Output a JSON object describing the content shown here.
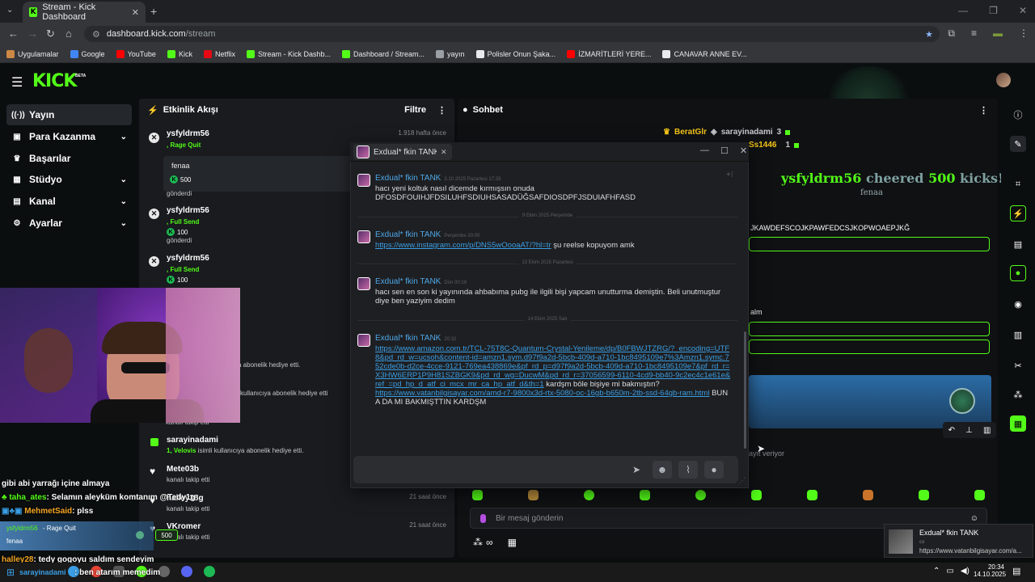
{
  "browser": {
    "tab_title": "Stream - Kick Dashboard",
    "url_host": "dashboard.kick.com",
    "url_path": "/stream",
    "bookmarks": [
      {
        "label": "Uygulamalar",
        "color": "#c84"
      },
      {
        "label": "Google",
        "color": "#4285f4"
      },
      {
        "label": "YouTube",
        "color": "#ff0000"
      },
      {
        "label": "Kick",
        "color": "#53fc18"
      },
      {
        "label": "Netflix",
        "color": "#e50914"
      },
      {
        "label": "Stream - Kick Dashb...",
        "color": "#53fc18"
      },
      {
        "label": "Dashboard / Stream...",
        "color": "#53fc18"
      },
      {
        "label": "yayın",
        "color": "#9aa0a6"
      },
      {
        "label": "Polisler Onun Şaka...",
        "color": "#e8eaed"
      },
      {
        "label": "İZMARİTLERİ YERE...",
        "color": "#ff0000"
      },
      {
        "label": "CANAVAR ANNE EV...",
        "color": "#e8eaed"
      }
    ]
  },
  "kick": {
    "logo": "KICK",
    "beta": "BETA",
    "sidebar": [
      {
        "label": "Yayın",
        "icon": "((·))",
        "chevron": false
      },
      {
        "label": "Para Kazanma",
        "icon": "▣",
        "chevron": true
      },
      {
        "label": "Başarılar",
        "icon": "♛",
        "chevron": false
      },
      {
        "label": "Stüdyo",
        "icon": "▦",
        "chevron": true
      },
      {
        "label": "Kanal",
        "icon": "▤",
        "chevron": true
      },
      {
        "label": "Ayarlar",
        "icon": "⚙",
        "chevron": true
      }
    ],
    "activity": {
      "title": "Etkinlik Akışı",
      "filter": "Filtre",
      "items": [
        {
          "user": "ysfyldrm56",
          "sub": ", Rage Quit",
          "note": "fenaa",
          "amount": "500",
          "action": "gönderdi",
          "time": "1.918 hafta önce"
        },
        {
          "user": "ysfyldrm56",
          "sub": ", Full Send",
          "amount": "100",
          "action": "gönderdi"
        },
        {
          "user": "ysfyldrm56",
          "sub": ", Full Send",
          "amount": "100",
          "action": "gönderdi"
        },
        {
          "user": "sarayinadami",
          "sub": "1, Velovis",
          "sub_rest": " isimli kullanıcıya abonelik hediye etti."
        },
        {
          "user": "Mete03b",
          "action": "kanalı takip etti"
        },
        {
          "user": "halley28g",
          "action": "kanalı takip etti",
          "time": "21 saat önce"
        },
        {
          "user": "VKromer",
          "action": "kanalı takip etti",
          "time": "21 saat önce"
        }
      ],
      "partial_texts": [
        "ya abonelik hediye etti.",
        "kullanıcıya abonelik hediye etti",
        "kanalı takip etti"
      ]
    },
    "chat": {
      "title": "Sohbet",
      "top_users": [
        {
          "name": "BeratGlr",
          "color": "#f5c518"
        },
        {
          "name": "sarayinadami",
          "count": "3",
          "color": "#c6c8cc"
        },
        {
          "name": "Ss1446",
          "count": "1",
          "color": "#f5c518"
        }
      ],
      "cheer_user": "ysfyldrm56",
      "cheer_mid": "cheered",
      "cheer_amount": "500",
      "cheer_end": "kicks!",
      "cheer_msg": "fenaa",
      "key_text": "JKAWDEFSCOJKPAWFEDCSJKOPWOAEPJKĞ",
      "partial": "alm",
      "partial2": "ayıt veriyor",
      "input_placeholder": "Bir mesaj gönderin",
      "infinity": "∞"
    },
    "overlay_chat": [
      {
        "text": "gibi abi yarrağı içine almaya",
        "color": "#ffffff"
      },
      {
        "user": "taha_ates",
        "text": ": Selamın aleyküm komtanım @Tedy1g",
        "color": "#53fc18"
      },
      {
        "user": "MehmetSaid",
        "text": ": plss",
        "color": "#f5a623"
      },
      {
        "user": "halley28",
        "text": ": tedy gogoyu saldım sendeyim",
        "color": "#f5a623"
      },
      {
        "user": "sarayinadami",
        "text": ": ben atarım memedim",
        "color": "#3a9ee4"
      }
    ],
    "overlay_alert": {
      "user": "ysfyldrm56",
      "type": "- Rage Quit",
      "msg": "fenaa",
      "amount": "500"
    }
  },
  "discord": {
    "window_title": "Exdual* fkin TANK",
    "messages": [
      {
        "author": "Exdual* fkin TANK",
        "time": "3.10.2025 Pazartesi 17:33",
        "text": "hacı yeni koltuk nasıl dicemde kırmışsın onuda\nDFOSDFOUIHJFDSILUHFSDIUHSASADÜĞSAFDIOSDPFJSDUIAFHFASD"
      },
      {
        "author": "Exdual* fkin TANK",
        "time": "Perşembe 20:00",
        "link": "https://www.instagram.com/p/DNS5wOooaAT/?hl=tr",
        "text": " şu reelse kopuyom amk"
      },
      {
        "author": "Exdual* fkin TANK",
        "time": "Dün 00:18",
        "text": "hacı sen en son ki yayınında ahbabıma pubg ile ilgili bişi yapcam unutturma demiştin. Beli unutmuştur diye ben yaziyim dedim"
      },
      {
        "author": "Exdual* fkin TANK",
        "time": "20:32",
        "link": "https://www.amazon.com.tr/TCL-75T8C-Quantum-Crystal-Yenileme/dp/B0FBWJTZRG/?_encoding=UTF8&pd_rd_w=ucsoh&content-id=amzn1.sym.d97f9a2d-5bcb-409d-a710-1bc8495109e7%3Amzn1.symc.752cde0b-d2ce-4cce-9121-769ea438869e&pf_rd_p=d97f9a2d-5bcb-409d-a710-1bc8495109e7&pf_rd_r=X3HW6ERP1P9H81SZBGK9&pd_rd_wg=DucwM&pd_rd_r=37056599-6110-4cd9-bb40-9c2ec4c1e61e&ref_=pd_hp_d_atf_ci_mcx_mr_ca_hp_atf_d&th=1",
        "text": " kardşm böle bişiye mi bakmıştın?",
        "link2": "https://www.vatanbilgisayar.com/amd-r7-9800x3d-rtx-5080-oc-16gb-b650m-2tb-ssd-64gb-ram.html",
        "text2": " BUNA DA MI BAKMIŞTTIN KARDŞM"
      }
    ],
    "separators": [
      "9 Ekim 2025 Perşembe",
      "13 Ekim 2025 Pazartesi",
      "14 Ekim 2025 Salı"
    ]
  },
  "notification": {
    "title": "Exdual* fkin TANK",
    "body": "https://www.vatanbilgisayar.com/a..."
  },
  "taskbar": {
    "time": "20:34",
    "date": "14.10.2025"
  }
}
